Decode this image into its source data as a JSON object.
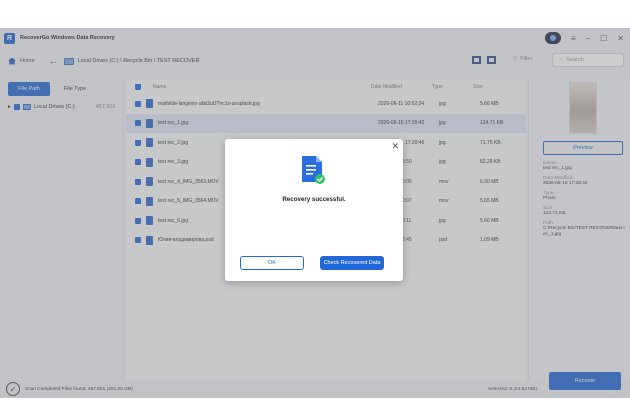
{
  "app": {
    "title": "RecoverGo Windows Data Recovery",
    "logo_letter": "R",
    "brand_color": "#2268d8"
  },
  "window": {
    "minimize": "–",
    "maximize": "☐",
    "close": "✕",
    "menu": "≡"
  },
  "nav": {
    "home_label": "Home",
    "back_icon": "←",
    "breadcrumb": "Local Drives (C:) \\ Recycle Bin \\ TEST RECOVER",
    "filter_label": "Filter",
    "search_placeholder": "Search"
  },
  "left": {
    "tab_file_path": "File Path",
    "tab_file_type": "File Type",
    "drive_label": "Local Drives (C:)",
    "drive_count": "457,501"
  },
  "list": {
    "col_name": "Name",
    "col_date": "Date Modified",
    "col_type": "Type",
    "col_size": "Size",
    "rows": [
      {
        "name": "mathilde-langevin-abb2uDThc1s-unsplash.jpg",
        "date": "2026-06-11 10:52:24",
        "type": "jpg",
        "size": "5.66 MB"
      },
      {
        "name": "test rec_1.jpg",
        "date": "2026-06-16 17:39:42",
        "type": "jpg",
        "size": "124.71 KB"
      },
      {
        "name": "test rec_2.jpg",
        "date": "2026-06-16 17:39:46",
        "type": "jpg",
        "size": "71.75 KB"
      },
      {
        "name": "test rec_3.jpg",
        "date": "06-16 17:39:50",
        "type": "jpg",
        "size": "82.29 KB"
      },
      {
        "name": "test rec_4_IMG_3563.MOV",
        "date": "06-16 17:40:00",
        "type": "mov",
        "size": "6.30 MB"
      },
      {
        "name": "test rec_5_IMG_3564.MOV",
        "date": "06-16 17:40:07",
        "type": "mov",
        "size": "5.65 MB"
      },
      {
        "name": "test rec_6.jpg",
        "date": "06-16 17:40:11",
        "type": "jpg",
        "size": "5.66 MB"
      },
      {
        "name": "Юлия-владимирова.psd",
        "date": "06-16 17:38:45",
        "type": "psd",
        "size": "1.09 MB"
      }
    ]
  },
  "details": {
    "preview_label": "Preview",
    "name_label": "Name",
    "name_value": "test rec_1.jpg",
    "date_label": "Date Modified",
    "date_value": "2026-06-16 17:39:42",
    "type_label": "Type",
    "type_value": "Photo",
    "size_label": "Size",
    "size_value": "124.71 KB",
    "path_label": "Path",
    "path_value": "C:/Recycle Bin/TEST RECOVER/test rec_1.jpg"
  },
  "status": {
    "scan_text": "Scan Completed Files found: 457,501 (201.00 GB)",
    "selected_text": "Selected: 8 (24.63 MB)",
    "recover_label": "Recover"
  },
  "modal": {
    "message": "Recovery successful.",
    "ok_label": "OK",
    "check_label": "Check Recovered Data",
    "close_icon": "✕"
  }
}
